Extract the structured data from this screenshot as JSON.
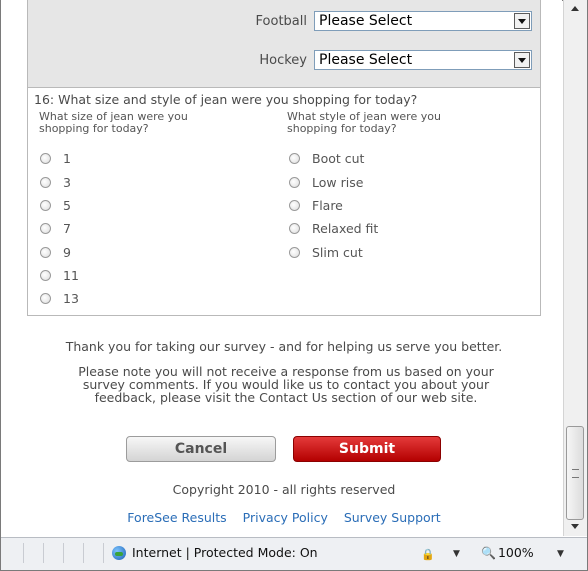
{
  "sports": [
    {
      "label": "Football",
      "value": "Please Select"
    },
    {
      "label": "Hockey",
      "value": "Please Select"
    }
  ],
  "question": {
    "title": "16: What size and style of jean were you shopping for today?",
    "size_header": "What size of jean were you shopping for today?",
    "style_header": "What style of jean were you shopping for today?",
    "sizes": [
      "1",
      "3",
      "5",
      "7",
      "9",
      "11",
      "13"
    ],
    "styles": [
      "Boot cut",
      "Low rise",
      "Flare",
      "Relaxed fit",
      "Slim cut"
    ]
  },
  "footer": {
    "thanks": "Thank you for taking our survey - and for helping us serve you better.",
    "note": "Please note you will not receive a response from us based on your survey comments. If you would like us to contact you about your feedback, please visit the Contact Us section of our web site.",
    "cancel_label": "Cancel",
    "submit_label": "Submit",
    "copyright": "Copyright 2010 - all rights reserved",
    "links": [
      "ForeSee Results",
      "Privacy Policy",
      "Survey Support"
    ]
  },
  "statusbar": {
    "zone": "Internet | Protected Mode: On",
    "zoom": "100%"
  },
  "colors": {
    "submit": "#c00000",
    "link": "#2a6db7",
    "panel": "#e6e6e6"
  }
}
